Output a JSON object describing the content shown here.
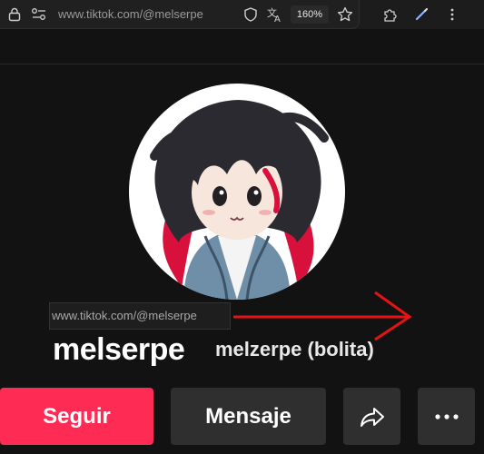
{
  "browser": {
    "url": "www.tiktok.com/@melserpe",
    "zoom": "160%",
    "icons": [
      "lock-icon",
      "site-settings-icon",
      "shield-icon",
      "translate-icon",
      "favorite-star-icon",
      "extensions-icon",
      "pen-icon",
      "more-vertical-icon"
    ]
  },
  "profile": {
    "url_tooltip": "www.tiktok.com/@melserpe",
    "username": "melserpe",
    "nickname": "melzerpe (bolita)"
  },
  "actions": {
    "follow_label": "Seguir",
    "message_label": "Mensaje",
    "share_icon": "share-arrow-icon",
    "more_icon": "more-horizontal-icon"
  },
  "colors": {
    "follow": "#fe2c55",
    "arrow": "#e51414",
    "background": "#121212"
  }
}
